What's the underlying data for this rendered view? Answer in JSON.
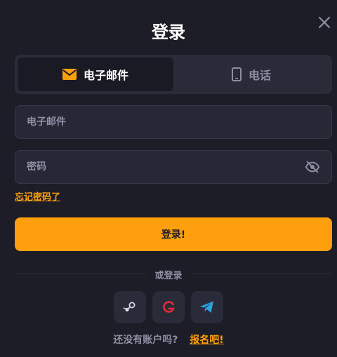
{
  "title": "登录",
  "tabs": [
    {
      "label": "电子邮件",
      "icon": "envelope-icon",
      "active": true
    },
    {
      "label": "电话",
      "icon": "phone-icon",
      "active": false
    }
  ],
  "email": {
    "placeholder": "电子邮件",
    "value": ""
  },
  "password": {
    "placeholder": "密码",
    "value": "",
    "toggle_icon": "eye-off-icon"
  },
  "forgot_label": "忘记密码了",
  "login_label": "登录!",
  "or_label": "或登录",
  "socials": [
    {
      "name": "steam",
      "icon": "steam-icon"
    },
    {
      "name": "google",
      "icon": "google-icon"
    },
    {
      "name": "telegram",
      "icon": "telegram-icon"
    }
  ],
  "signup": {
    "prompt": "还没有账户吗?",
    "link": "报名吧!"
  },
  "colors": {
    "background": "#1d1d27",
    "accent": "#ff9f0e",
    "muted": "#8d8fa3",
    "panel": "#2a2b38",
    "field": "#272836"
  }
}
